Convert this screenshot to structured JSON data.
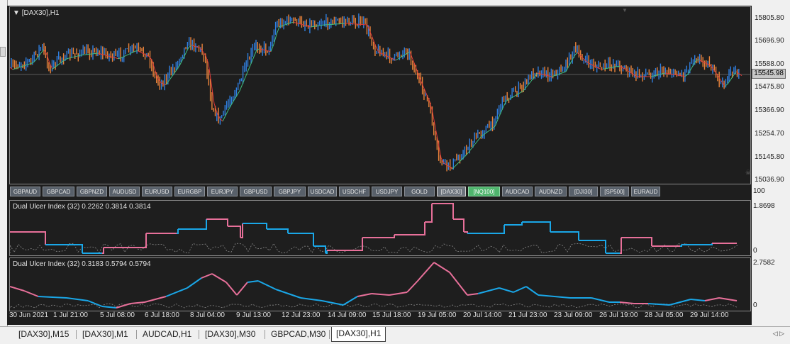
{
  "chart": {
    "title": "[DAX30],H1",
    "price_ticks": [
      "15805.80",
      "15696.90",
      "15588.00",
      "15475.80",
      "15366.90",
      "15254.70",
      "15145.80",
      "15036.90"
    ],
    "current_price": "15545.98"
  },
  "symbols": [
    {
      "label": "GBPAUD"
    },
    {
      "label": "GBPCAD"
    },
    {
      "label": "GBPNZD"
    },
    {
      "label": "AUDUSD"
    },
    {
      "label": "EURUSD"
    },
    {
      "label": "EURGBP"
    },
    {
      "label": "EURJPY"
    },
    {
      "label": "GBPUSD"
    },
    {
      "label": "GBPJPY"
    },
    {
      "label": "USDCAD"
    },
    {
      "label": "USDCHF"
    },
    {
      "label": "USDJPY"
    },
    {
      "label": "GOLD"
    },
    {
      "label": "[DAX30]",
      "state": "active"
    },
    {
      "label": "[NQ100]",
      "state": "green"
    },
    {
      "label": "AUDCAD"
    },
    {
      "label": "AUDNZD"
    },
    {
      "label": "[DJI30]"
    },
    {
      "label": "[SP500]"
    },
    {
      "label": "EURAUD"
    }
  ],
  "symbar_axis_label": "100",
  "indicator1": {
    "title": "Dual Ulcer Index (32) 0.2262 0.3814 0.3814",
    "max": "1.8698",
    "min": "0"
  },
  "indicator2": {
    "title": "Dual Ulcer Index (32) 0.3183 0.5794 0.5794",
    "max": "2.7582",
    "min": "0"
  },
  "x_ticks": [
    "30 Jun 2021",
    "1 Jul 21:00",
    "5 Jul 08:00",
    "6 Jul 18:00",
    "8 Jul 04:00",
    "9 Jul 13:00",
    "12 Jul 23:00",
    "14 Jul 09:00",
    "15 Jul 18:00",
    "19 Jul 05:00",
    "20 Jul 14:00",
    "21 Jul 23:00",
    "23 Jul 09:00",
    "26 Jul 19:00",
    "28 Jul 05:00",
    "29 Jul 14:00"
  ],
  "tabs": [
    {
      "label": "[DAX30],M15"
    },
    {
      "label": "[DAX30],M1"
    },
    {
      "label": "AUDCAD,H1"
    },
    {
      "label": "[DAX30],M30"
    },
    {
      "label": "GBPCAD,M30"
    },
    {
      "label": "[DAX30],H1",
      "active": true
    }
  ],
  "colors": {
    "bg": "#1e1e1e",
    "bull": "#2f7fe0",
    "bear": "#e8823a",
    "ma_up": "#40c080",
    "ma_down": "#e23a3a",
    "ui_blue": "#1aa7e8",
    "ui_pink": "#e8709a",
    "baseline": "#8a8a8a"
  },
  "icons": {
    "dropdown": "triangle-down-icon",
    "scroll_left": "scroll-left-icon",
    "scroll_right": "scroll-right-icon",
    "skull": "skull-icon"
  }
}
